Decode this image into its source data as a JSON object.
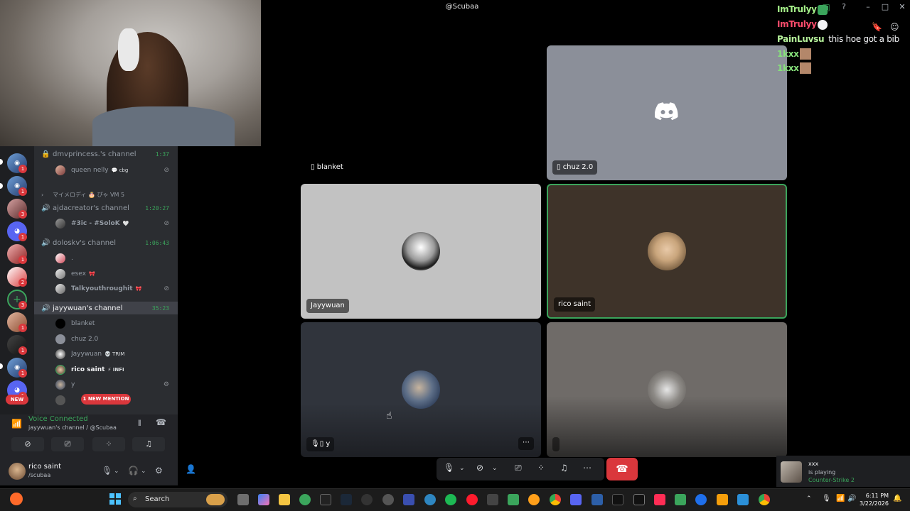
{
  "window": {
    "title": "@Scubaa",
    "controls": [
      "–",
      "□",
      "✕"
    ]
  },
  "chat_overlay": [
    {
      "user": "ImTrulyy",
      "color": "#a6f28a",
      "message": ""
    },
    {
      "user": "ImTrulyy",
      "color": "#ff4d6d",
      "message": ""
    },
    {
      "user": "PainLuvsu",
      "color": "#b6f29b",
      "message": "this hoe got a bib"
    },
    {
      "user": "1kxx",
      "color": "#86e07a",
      "message": ""
    },
    {
      "user": "1kxx",
      "color": "#86e07a",
      "message": ""
    }
  ],
  "server_rail": {
    "badges": [
      "1",
      "1",
      "3",
      "1",
      "1",
      "2",
      "3",
      "1",
      "1",
      "1",
      "1"
    ],
    "new_label": "NEW"
  },
  "channels": [
    {
      "type": "locked",
      "name": "dmvprincess.'s channel",
      "time": "1:37",
      "users": [
        {
          "name": "queen nelly",
          "tag": "💬 cbg"
        }
      ]
    },
    {
      "type": "category",
      "name": "マイメロディ 🎂 ぴゃ VM 5"
    },
    {
      "type": "voice",
      "name": "ajdacreator's channel",
      "time": "1:20:27",
      "users": [
        {
          "name": "#3ic - #SoloK",
          "tag": "🤍"
        }
      ]
    },
    {
      "type": "voice",
      "name": "doloskv's channel",
      "time": "1:06:43",
      "users": [
        {
          "name": ".",
          "tag": ""
        },
        {
          "name": "esex",
          "tag": "🎀"
        },
        {
          "name": "Talkyouthroughit",
          "tag": "🎀"
        }
      ]
    },
    {
      "type": "voice",
      "name": "jayywuan's channel",
      "time": "35:23",
      "active": true,
      "users": [
        {
          "name": "blanket",
          "tag": ""
        },
        {
          "name": "chuz 2.0",
          "tag": ""
        },
        {
          "name": "Jayywuan",
          "tag": "💀 TRIM"
        },
        {
          "name": "rico saint",
          "tag": "⚡ INFI"
        },
        {
          "name": "y",
          "tag": ""
        }
      ]
    }
  ],
  "new_mention": "1 NEW MENTION",
  "voice_panel": {
    "status": "Voice Connected",
    "channel": "jayywuan's channel / @Scubaa"
  },
  "user_panel": {
    "name": "rico saint",
    "status": "/scubaa"
  },
  "tiles": [
    {
      "name": "blanket",
      "bg": "#000000"
    },
    {
      "name": "chuz 2.0",
      "bg": "#8b8f99"
    },
    {
      "name": "Jayywuan",
      "bg": "#c2c2c2"
    },
    {
      "name": "rico saint",
      "bg": "#3e3329"
    },
    {
      "name": "y",
      "bg": "#30343c"
    },
    {
      "name": "",
      "bg": "#6f6b68"
    }
  ],
  "activity": {
    "user": "xxx",
    "verb": "is playing",
    "game": "Counter-Strike 2"
  },
  "taskbar": {
    "search": "Search",
    "time": "6:11 PM",
    "date": "3/22/2026"
  },
  "colors": {
    "discord_blurple": "#5865f2",
    "speaking_green": "#3ba55c",
    "end_call_red": "#da373c"
  }
}
